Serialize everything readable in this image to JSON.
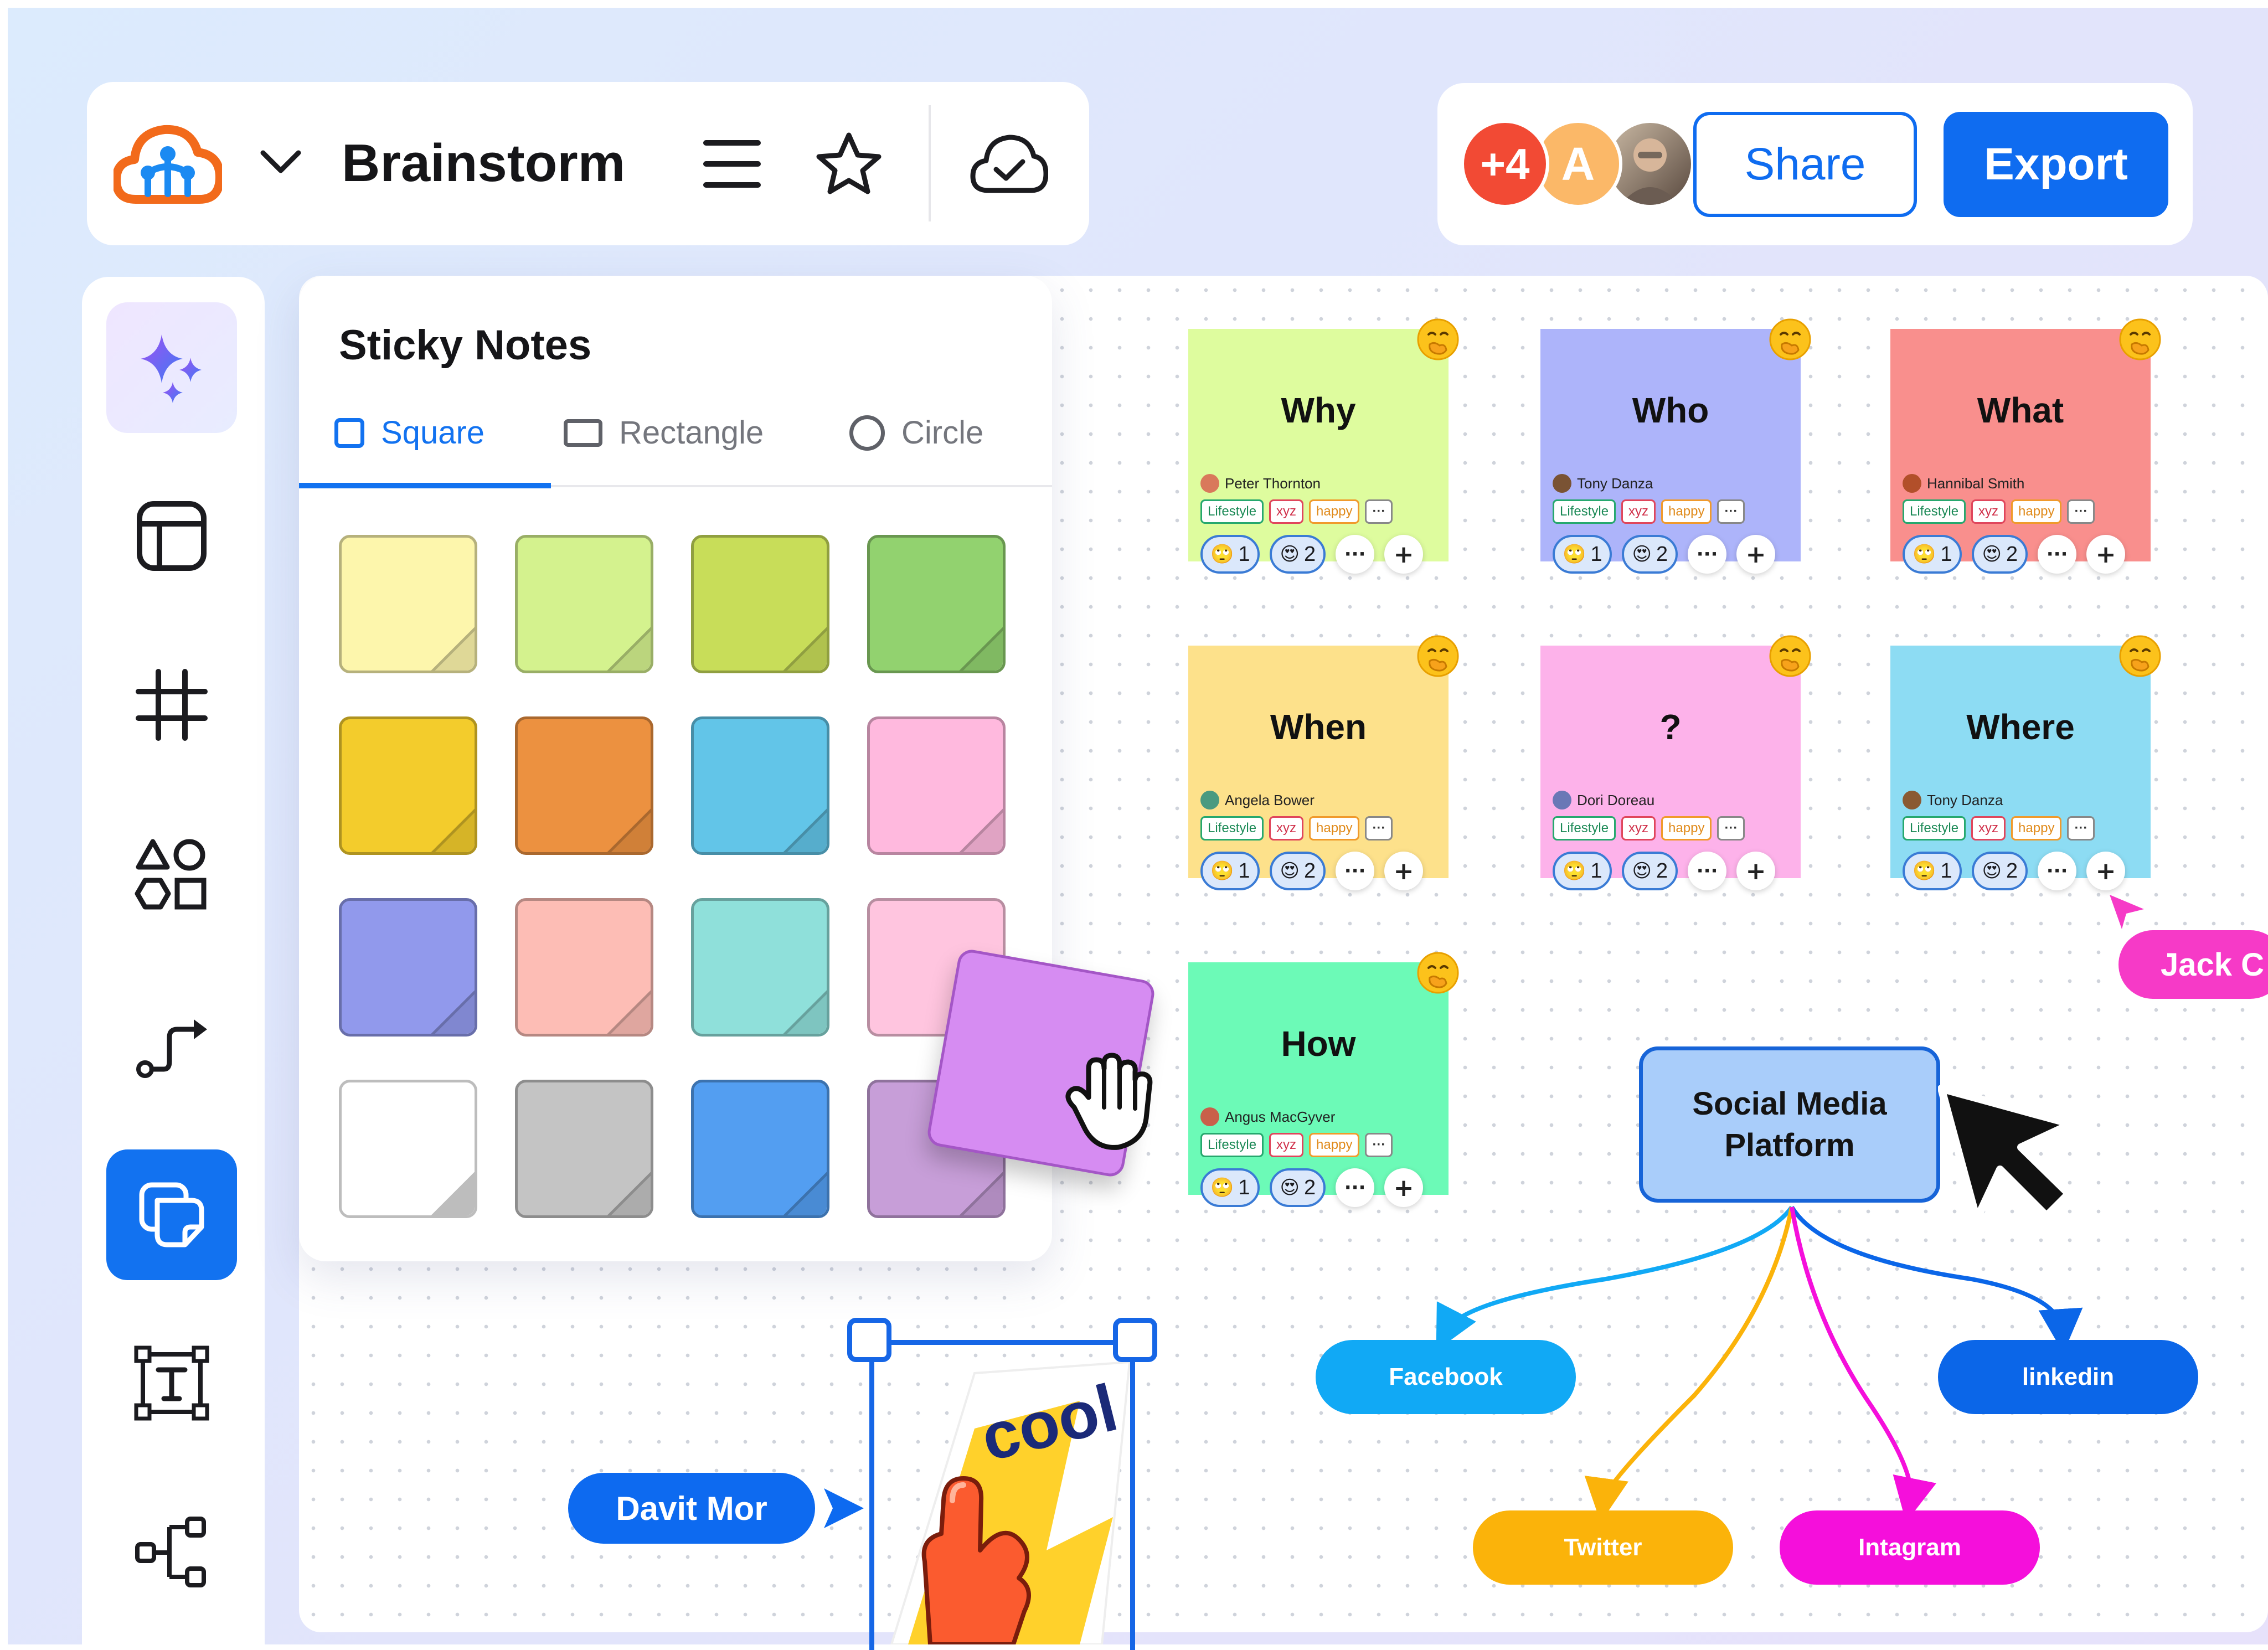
{
  "header": {
    "board_title": "Brainstorm",
    "logo_icon": "cloud-logo-icon",
    "dropdown_icon": "chevron-down-icon",
    "menu_icon": "hamburger-menu-icon",
    "favorite_icon": "star-icon",
    "sync_icon": "cloud-check-icon"
  },
  "collaborators": {
    "extra_count": "+4",
    "avatar_initial": "A",
    "share_label": "Share",
    "export_label": "Export"
  },
  "sidebar": {
    "items": [
      {
        "name": "ai-sparkle",
        "icon": "sparkle-icon"
      },
      {
        "name": "layout",
        "icon": "layout-icon"
      },
      {
        "name": "grid",
        "icon": "frame-grid-icon"
      },
      {
        "name": "shapes",
        "icon": "shapes-icon"
      },
      {
        "name": "connector",
        "icon": "connector-arrow-icon"
      },
      {
        "name": "sticky-notes",
        "icon": "sticky-notes-icon",
        "active": true
      },
      {
        "name": "text",
        "icon": "text-box-icon"
      },
      {
        "name": "mind-map",
        "icon": "mind-map-icon"
      }
    ]
  },
  "sticky_panel": {
    "title": "Sticky Notes",
    "tabs": [
      {
        "label": "Square",
        "active": true
      },
      {
        "label": "Rectangle",
        "active": false
      },
      {
        "label": "Circle",
        "active": false
      }
    ],
    "colors": [
      "#fdf6ac",
      "#d4f28e",
      "#c8dd59",
      "#92d26f",
      "#f3cc2c",
      "#ec9140",
      "#62c5e8",
      "#ffb9de",
      "#9199ec",
      "#fdbdb5",
      "#8fe0da",
      "#ffc5df",
      "#ffffff",
      "#c4c4c4",
      "#539ef1",
      "#c79ed8"
    ],
    "dragged_color": "#d68cf2"
  },
  "cards": [
    {
      "title": "Why",
      "author": "Peter Thornton",
      "color": "#defc9e"
    },
    {
      "title": "Who",
      "author": "Tony Danza",
      "color": "#adb4fa"
    },
    {
      "title": "What",
      "author": "Hannibal Smith",
      "color": "#f98f8d"
    },
    {
      "title": "When",
      "author": "Angela Bower",
      "color": "#fde18b"
    },
    {
      "title": "?",
      "author": "Dori Doreau",
      "color": "#fdb2ea"
    },
    {
      "title": "Where",
      "author": "Tony Danza",
      "color": "#8ddcf3"
    },
    {
      "title": "How",
      "author": "Angus MacGyver",
      "color": "#6cfab7"
    }
  ],
  "card_tags": [
    "Lifestyle",
    "xyz",
    "happy",
    "···"
  ],
  "card_reactions": [
    {
      "emoji": "🙄",
      "count": "1"
    },
    {
      "emoji": "😍",
      "count": "2"
    }
  ],
  "card_actions": {
    "more": "···",
    "add": "+"
  },
  "mindmap": {
    "root": "Social Media Platform",
    "root_lines": [
      "Social Media",
      "Platform"
    ],
    "children": [
      {
        "label": "Facebook",
        "color": "#11a9f5"
      },
      {
        "label": "linkedin",
        "color": "#0b66e8"
      },
      {
        "label": "Twitter",
        "color": "#fbb30a"
      },
      {
        "label": "Intagram",
        "color": "#f50fdb"
      }
    ]
  },
  "cursors": {
    "davit": "Davit Mor",
    "jack": "Jack C"
  },
  "sticker_text": "cool"
}
